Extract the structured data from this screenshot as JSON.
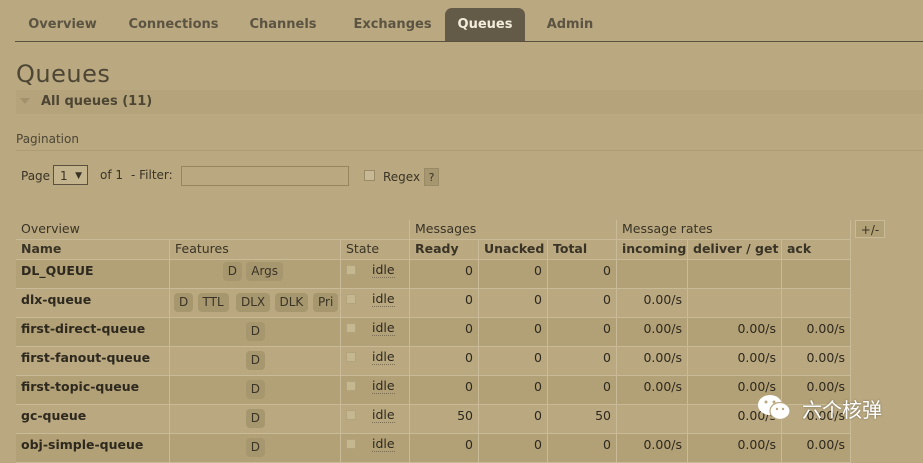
{
  "nav": {
    "tabs": [
      "Overview",
      "Connections",
      "Channels",
      "Exchanges",
      "Queues",
      "Admin"
    ],
    "active": "Queues"
  },
  "page": {
    "title": "Queues",
    "section_label": "All queues (11)",
    "pagination_label": "Pagination"
  },
  "filters": {
    "page_label": "Page",
    "page_value": "1",
    "of_label": "of 1",
    "filter_label": "- Filter:",
    "filter_value": "",
    "regex_label": "Regex",
    "help_label": "?"
  },
  "table": {
    "groups": [
      "Overview",
      "Messages",
      "Message rates"
    ],
    "columns": [
      "Name",
      "Features",
      "State",
      "Ready",
      "Unacked",
      "Total",
      "incoming",
      "deliver / get",
      "ack"
    ],
    "toggle_label": "+/-",
    "rows": [
      {
        "name": "DL_QUEUE",
        "features": [
          "D",
          "Args"
        ],
        "state": "idle",
        "ready": "0",
        "unacked": "0",
        "total": "0",
        "incoming": "",
        "deliver": "",
        "ack": ""
      },
      {
        "name": "dlx-queue",
        "features": [
          "D",
          "TTL",
          "DLX",
          "DLK",
          "Pri"
        ],
        "state": "idle",
        "ready": "0",
        "unacked": "0",
        "total": "0",
        "incoming": "0.00/s",
        "deliver": "",
        "ack": ""
      },
      {
        "name": "first-direct-queue",
        "features": [
          "D"
        ],
        "state": "idle",
        "ready": "0",
        "unacked": "0",
        "total": "0",
        "incoming": "0.00/s",
        "deliver": "0.00/s",
        "ack": "0.00/s"
      },
      {
        "name": "first-fanout-queue",
        "features": [
          "D"
        ],
        "state": "idle",
        "ready": "0",
        "unacked": "0",
        "total": "0",
        "incoming": "0.00/s",
        "deliver": "0.00/s",
        "ack": "0.00/s"
      },
      {
        "name": "first-topic-queue",
        "features": [
          "D"
        ],
        "state": "idle",
        "ready": "0",
        "unacked": "0",
        "total": "0",
        "incoming": "0.00/s",
        "deliver": "0.00/s",
        "ack": "0.00/s"
      },
      {
        "name": "gc-queue",
        "features": [
          "D"
        ],
        "state": "idle",
        "ready": "50",
        "unacked": "0",
        "total": "50",
        "incoming": "",
        "deliver": "0.00/s",
        "ack": "0.00/s"
      },
      {
        "name": "obj-simple-queue",
        "features": [
          "D"
        ],
        "state": "idle",
        "ready": "0",
        "unacked": "0",
        "total": "0",
        "incoming": "0.00/s",
        "deliver": "0.00/s",
        "ack": "0.00/s"
      }
    ]
  },
  "watermark": {
    "text": "六个核弹",
    "icon": "wechat-icon"
  }
}
